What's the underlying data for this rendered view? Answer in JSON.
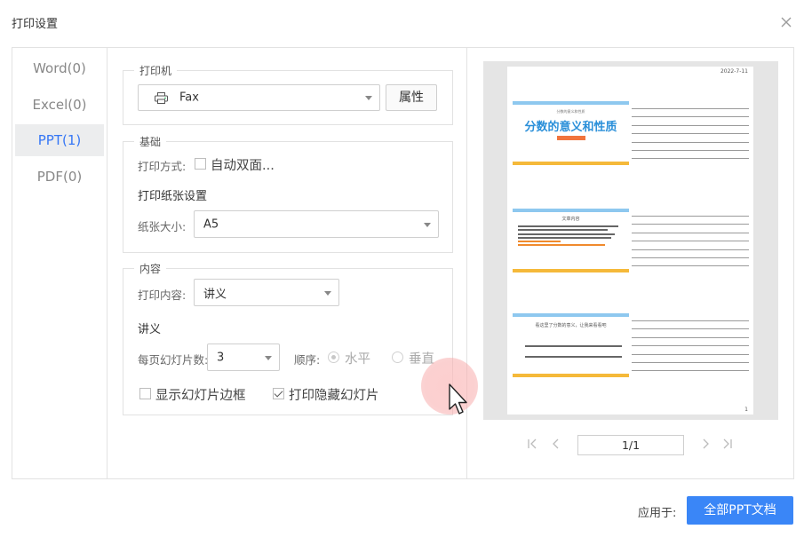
{
  "window": {
    "title": "打印设置"
  },
  "file_types": [
    {
      "label": "Word(0)"
    },
    {
      "label": "Excel(0)"
    },
    {
      "label": "PPT(1)",
      "active": true
    },
    {
      "label": "PDF(0)"
    }
  ],
  "printer": {
    "legend": "打印机",
    "selected": "Fax",
    "properties_button": "属性"
  },
  "basic": {
    "legend": "基础",
    "print_mode_label": "打印方式:",
    "duplex_label": "自动双面...",
    "duplex_checked": false,
    "paper_settings_label": "打印纸张设置",
    "paper_size_label": "纸张大小:",
    "paper_size": "A5"
  },
  "content": {
    "legend": "内容",
    "print_content_label": "打印内容:",
    "print_content": "讲义",
    "handout_label": "讲义",
    "slides_per_page_label": "每页幻灯片数:",
    "slides_per_page": "3",
    "order_label": "顺序:",
    "order_horizontal": "水平",
    "order_vertical": "垂直",
    "order_selected": "水平",
    "show_border_label": "显示幻灯片边框",
    "show_border_checked": false,
    "print_hidden_label": "打印隐藏幻灯片",
    "print_hidden_checked": true
  },
  "preview": {
    "date": "2022-7-11",
    "page_number": "1",
    "slide1": {
      "subtitle": "分数的意义和性质",
      "title": "分数的意义和性质"
    },
    "slide2": {
      "heading": "文章内容"
    },
    "slide3": {
      "heading": "看这里了分数的意义，让我来看看吧"
    },
    "page_indicator": "1/1"
  },
  "footer": {
    "apply_label": "应用于:",
    "apply_button": "全部PPT文档"
  },
  "colors": {
    "accent": "#3a86f7",
    "active_tab_text": "#3677f5",
    "slide_title": "#2a8fd9"
  }
}
